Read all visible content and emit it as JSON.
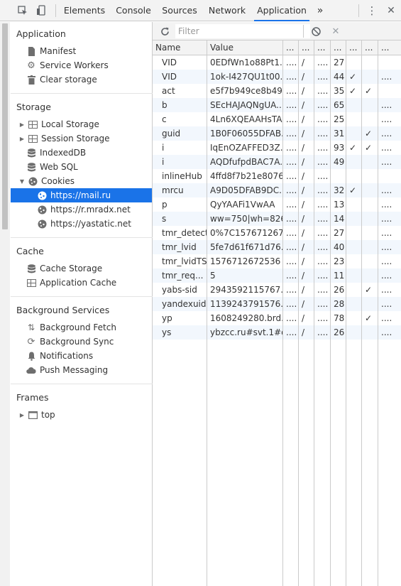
{
  "toolbar": {
    "tabs": [
      "Elements",
      "Console",
      "Sources",
      "Network",
      "Application"
    ],
    "active_tab": "Application",
    "more_tabs": "»",
    "menu": "⋮",
    "close": "✕"
  },
  "sidebar": {
    "application": {
      "title": "Application",
      "items": [
        {
          "label": "Manifest",
          "icon": "manifest-icon"
        },
        {
          "label": "Service Workers",
          "icon": "gear-icon"
        },
        {
          "label": "Clear storage",
          "icon": "trash-icon"
        }
      ]
    },
    "storage": {
      "title": "Storage",
      "items": [
        {
          "label": "Local Storage",
          "icon": "grid-icon",
          "expandable": true
        },
        {
          "label": "Session Storage",
          "icon": "grid-icon",
          "expandable": true
        },
        {
          "label": "IndexedDB",
          "icon": "database-icon"
        },
        {
          "label": "Web SQL",
          "icon": "database-icon"
        },
        {
          "label": "Cookies",
          "icon": "cookie-icon",
          "expanded": true
        }
      ],
      "cookie_domains": [
        "https://mail.ru",
        "https://r.mradx.net",
        "https://yastatic.net"
      ],
      "selected_domain": "https://mail.ru"
    },
    "cache": {
      "title": "Cache",
      "items": [
        {
          "label": "Cache Storage",
          "icon": "database-icon"
        },
        {
          "label": "Application Cache",
          "icon": "grid-icon"
        }
      ]
    },
    "background": {
      "title": "Background Services",
      "items": [
        {
          "label": "Background Fetch",
          "icon": "fetch-arrows-icon"
        },
        {
          "label": "Background Sync",
          "icon": "sync-icon"
        },
        {
          "label": "Notifications",
          "icon": "bell-icon"
        },
        {
          "label": "Push Messaging",
          "icon": "cloud-icon"
        }
      ]
    },
    "frames": {
      "title": "Frames",
      "items": [
        {
          "label": "top",
          "icon": "frame-icon",
          "expandable": true
        }
      ]
    }
  },
  "cookies_panel": {
    "filter_placeholder": "Filter",
    "columns": [
      "Name",
      "Value",
      "...",
      "...",
      "...",
      "...",
      "...",
      "...",
      "..."
    ],
    "rows": [
      [
        "VID",
        "0EDfWn1o88Pt1...",
        "....",
        "/",
        "....",
        "27",
        "",
        "",
        ""
      ],
      [
        "VID",
        "1ok-I427QU1t00...",
        "....",
        "/",
        "....",
        "44",
        "✓",
        "",
        "...."
      ],
      [
        "act",
        "e5f7b949ce8b49...",
        "....",
        "/",
        "....",
        "35",
        "✓",
        "✓",
        ""
      ],
      [
        "b",
        "SEcHAJAQNgUA...",
        "....",
        "/",
        "....",
        "65",
        "",
        "",
        "...."
      ],
      [
        "c",
        "4Ln6XQEAAHsTA...",
        "....",
        "/",
        "....",
        "25",
        "",
        "",
        "...."
      ],
      [
        "guid",
        "1B0F06055DFAB...",
        "....",
        "/",
        "....",
        "31",
        "",
        "✓",
        "...."
      ],
      [
        "i",
        "IqEnOZAFFED3Z...",
        "....",
        "/",
        "....",
        "93",
        "✓",
        "✓",
        "...."
      ],
      [
        "i",
        "AQDfufpdBAC7A...",
        "....",
        "/",
        "....",
        "49",
        "",
        "",
        "...."
      ],
      [
        "inlineHub",
        "4ffd8f7b21e8076...",
        "....",
        "/",
        "....",
        "",
        "",
        "",
        ""
      ],
      [
        "mrcu",
        "A9D05DFAB9DC...",
        "....",
        "/",
        "....",
        "32",
        "✓",
        "",
        "...."
      ],
      [
        "p",
        "QyYAAFi1VwAA",
        "....",
        "/",
        "....",
        "13",
        "",
        "",
        "...."
      ],
      [
        "s",
        "ww=750|wh=826",
        "....",
        "/",
        "....",
        "14",
        "",
        "",
        "...."
      ],
      [
        "tmr_detect",
        "0%7C157671267...",
        "....",
        "/",
        "....",
        "27",
        "",
        "",
        "...."
      ],
      [
        "tmr_lvid",
        "5fe7d61f671d76...",
        "....",
        "/",
        "....",
        "40",
        "",
        "",
        "...."
      ],
      [
        "tmr_lvidTS",
        "1576712672536",
        "....",
        "/",
        "....",
        "23",
        "",
        "",
        "...."
      ],
      [
        "tmr_req...",
        "5",
        "....",
        "/",
        "....",
        "11",
        "",
        "",
        "...."
      ],
      [
        "yabs-sid",
        "2943592115767...",
        "....",
        "/",
        "....",
        "26",
        "",
        "✓",
        "...."
      ],
      [
        "yandexuid",
        "1139243791576...",
        "....",
        "/",
        "....",
        "28",
        "",
        "",
        "...."
      ],
      [
        "yp",
        "1608249280.brd....",
        "....",
        "/",
        "....",
        "78",
        "",
        "✓",
        "...."
      ],
      [
        "ys",
        "ybzcc.ru#svt.1#d...",
        "....",
        "/",
        "....",
        "26",
        "",
        "",
        "...."
      ]
    ]
  }
}
